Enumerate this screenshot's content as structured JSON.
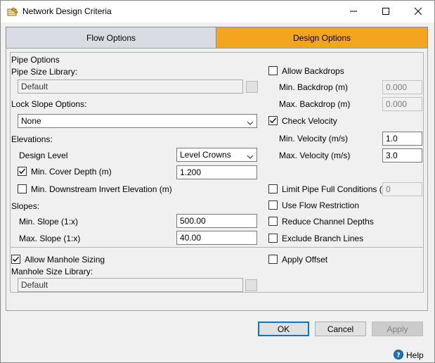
{
  "window": {
    "title": "Network Design Criteria"
  },
  "tabs": [
    {
      "label": "Flow Options",
      "selected": false
    },
    {
      "label": "Design Options",
      "selected": true
    }
  ],
  "left": {
    "pipe_options_header": "Pipe Options",
    "pipe_size_library_label": "Pipe Size Library:",
    "pipe_size_library_value": "Default",
    "lock_slope_label": "Lock Slope Options:",
    "lock_slope_value": "None",
    "elevations_label": "Elevations:",
    "design_level_label": "Design Level",
    "design_level_value": "Level Crowns",
    "min_cover_label": "Min. Cover Depth (m)",
    "min_cover_checked": true,
    "min_cover_value": "1.200",
    "min_downstream_label": "Min. Downstream Invert Elevation (m)",
    "min_downstream_checked": false,
    "slopes_label": "Slopes:",
    "min_slope_label": "Min. Slope (1:x)",
    "min_slope_value": "500.00",
    "max_slope_label": "Max. Slope (1:x)",
    "max_slope_value": "40.00",
    "allow_manhole_label": "Allow Manhole Sizing",
    "allow_manhole_checked": true,
    "manhole_library_label": "Manhole Size Library:",
    "manhole_library_value": "Default"
  },
  "right": {
    "allow_backdrops_label": "Allow Backdrops",
    "allow_backdrops_checked": false,
    "min_backdrop_label": "Min. Backdrop (m)",
    "min_backdrop_value": "0.000",
    "max_backdrop_label": "Max. Backdrop (m)",
    "max_backdrop_value": "0.000",
    "check_velocity_label": "Check Velocity",
    "check_velocity_checked": true,
    "min_velocity_label": "Min. Velocity (m/s)",
    "min_velocity_value": "1.0",
    "max_velocity_label": "Max. Velocity (m/s)",
    "max_velocity_value": "3.0",
    "limit_pipe_full_label": "Limit Pipe Full Conditions (%)",
    "limit_pipe_full_checked": false,
    "limit_pipe_full_value": "0",
    "use_flow_restriction_label": "Use Flow Restriction",
    "use_flow_restriction_checked": false,
    "reduce_channel_label": "Reduce Channel Depths",
    "reduce_channel_checked": false,
    "exclude_branch_label": "Exclude Branch Lines",
    "exclude_branch_checked": false,
    "apply_offset_label": "Apply Offset",
    "apply_offset_checked": false
  },
  "buttons": {
    "ok": "OK",
    "cancel": "Cancel",
    "apply": "Apply",
    "help": "Help"
  },
  "colors": {
    "tab_selected": "#f4a51f",
    "tab_unselected": "#d9dde3",
    "focus_blue": "#0078d7"
  },
  "icons": {
    "app": "network-pencil-icon",
    "help": "help-circle-icon",
    "dropdown": "chevron-down-icon"
  }
}
